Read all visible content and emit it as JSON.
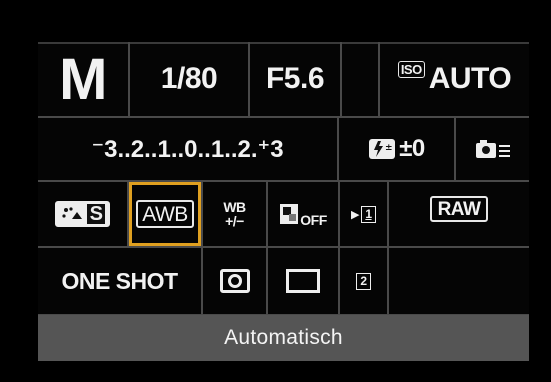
{
  "mode": {
    "value": "M"
  },
  "shutter": {
    "value": "1/80"
  },
  "aperture": {
    "value": "F5.6"
  },
  "iso": {
    "tag": "ISO",
    "value": "AUTO"
  },
  "exposure_scale": {
    "value": "⁻3..2..1..0..1..2.⁺3"
  },
  "flash_comp": {
    "value": "±0"
  },
  "picture_style": {
    "value": "S"
  },
  "white_balance": {
    "value": "AWB",
    "selected": true
  },
  "wb_shift": {
    "top": "WB",
    "bottom": "+/−"
  },
  "alo": {
    "value": "OFF"
  },
  "card1": {
    "value": "1"
  },
  "card2": {
    "value": "2"
  },
  "quality": {
    "value": "RAW"
  },
  "af_mode": {
    "value": "ONE SHOT"
  },
  "status": {
    "text": "Automatisch"
  },
  "colors": {
    "accent": "#e0a020",
    "status_bar": "#555555",
    "grid_lines": "#4a4a4a"
  }
}
